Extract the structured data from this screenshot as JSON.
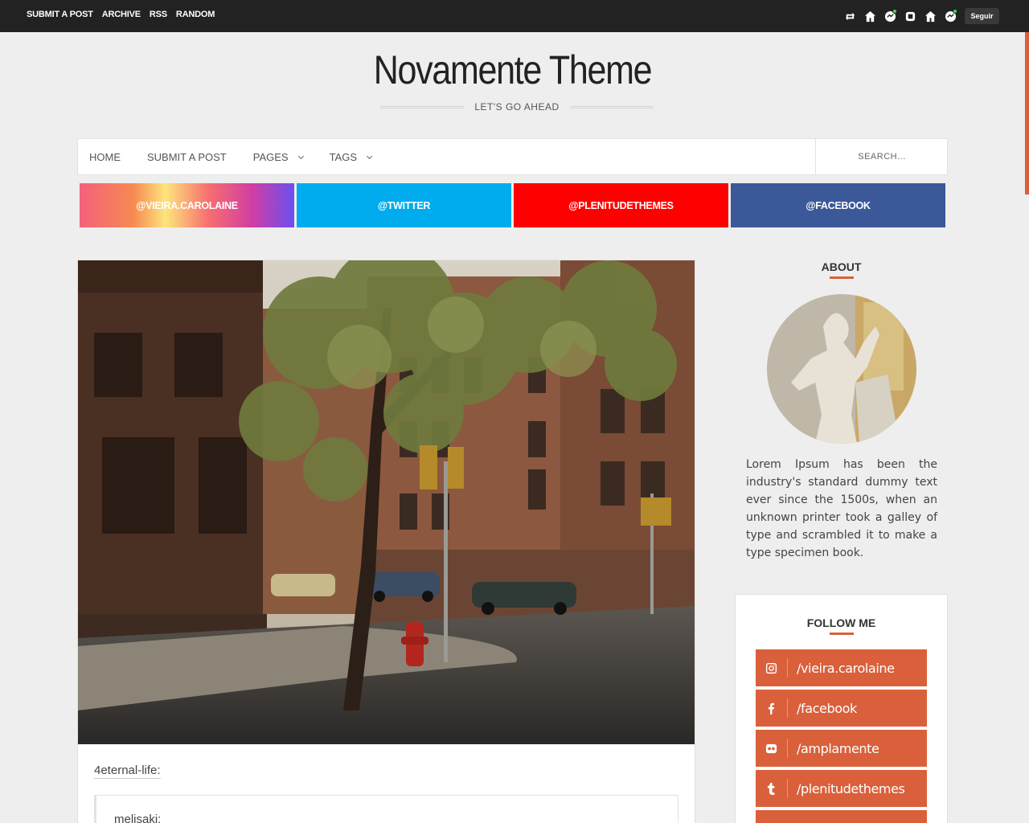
{
  "topbar": {
    "links": [
      "SUBMIT A POST",
      "ARCHIVE",
      "RSS",
      "RANDOM"
    ],
    "icons": [
      "reblog-icon",
      "home-icon",
      "blog-avatar-icon",
      "dashboard-icon",
      "home-icon",
      "blog-avatar-icon"
    ],
    "follow_label": "Seguir"
  },
  "header": {
    "title": "Novamente Theme",
    "tagline": "LET'S GO AHEAD"
  },
  "nav": {
    "items": [
      {
        "label": "HOME",
        "dropdown": false
      },
      {
        "label": "SUBMIT A POST",
        "dropdown": false
      },
      {
        "label": "PAGES",
        "dropdown": true
      },
      {
        "label": "TAGS",
        "dropdown": true
      }
    ],
    "search_placeholder": "SEARCH..."
  },
  "social_bar": [
    {
      "label": "@VIEIRA.CAROLAINE"
    },
    {
      "label": "@TWITTER",
      "color": "#00aced"
    },
    {
      "label": "@PLENITUDETHEMES",
      "color": "#ff0000"
    },
    {
      "label": "@FACEBOOK",
      "color": "#3b5998"
    }
  ],
  "post": {
    "reblog_user": "4eternal-life:",
    "quote_user": "melisaki:"
  },
  "sidebar": {
    "about_title": "ABOUT",
    "about_text": "Lorem Ipsum has been the industry's standard dummy text ever since the 1500s, when an unknown printer took a galley of type and scrambled it to make a type specimen book.",
    "follow_title": "FOLLOW ME",
    "follow_links": [
      {
        "icon": "instagram-icon",
        "label": "/vieira.carolaine"
      },
      {
        "icon": "facebook-icon",
        "label": "/facebook"
      },
      {
        "icon": "flickr-icon",
        "label": "/amplamente"
      },
      {
        "icon": "tumblr-icon",
        "label": "/plenitudethemes"
      }
    ]
  },
  "colors": {
    "accent": "#d9603b",
    "topbar": "#222222",
    "background": "#eeeeee"
  }
}
